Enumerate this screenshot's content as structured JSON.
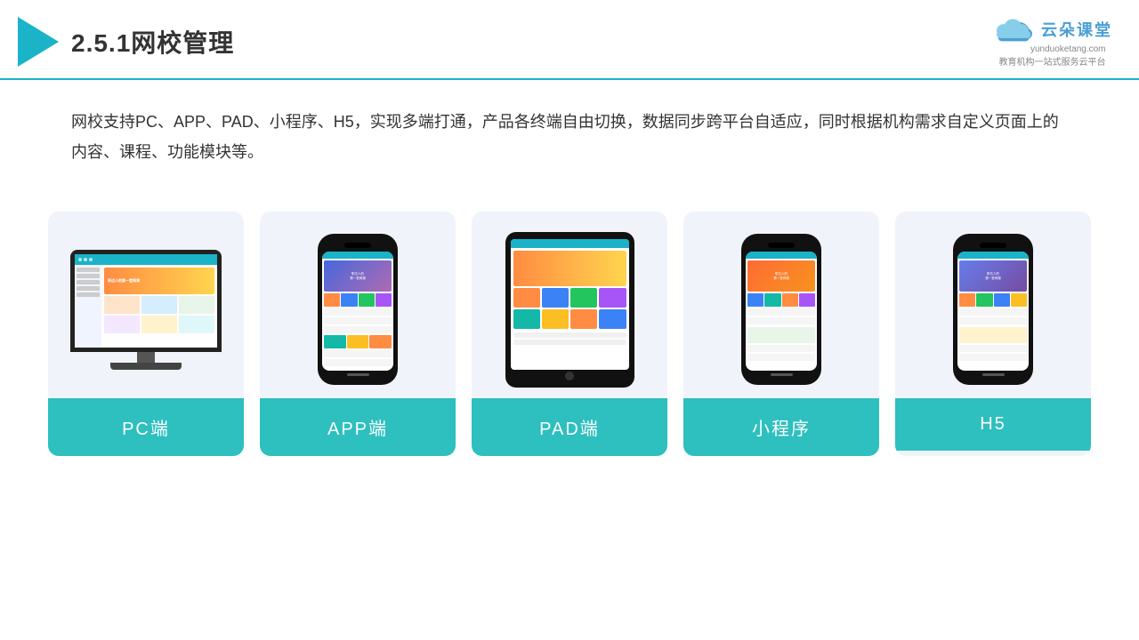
{
  "header": {
    "title": "2.5.1网校管理",
    "brand_name": "云朵课堂",
    "brand_url": "yunduoketang.com",
    "brand_tagline": "教育机构一站式服务云平台"
  },
  "description": "网校支持PC、APP、PAD、小程序、H5，实现多端打通，产品各终端自由切换，数据同步跨平台自适应，同时根据机构需求自定义页面上的内容、课程、功能模块等。",
  "cards": [
    {
      "id": "pc",
      "label": "PC端"
    },
    {
      "id": "app",
      "label": "APP端"
    },
    {
      "id": "pad",
      "label": "PAD端"
    },
    {
      "id": "miniapp",
      "label": "小程序"
    },
    {
      "id": "h5",
      "label": "H5"
    }
  ]
}
